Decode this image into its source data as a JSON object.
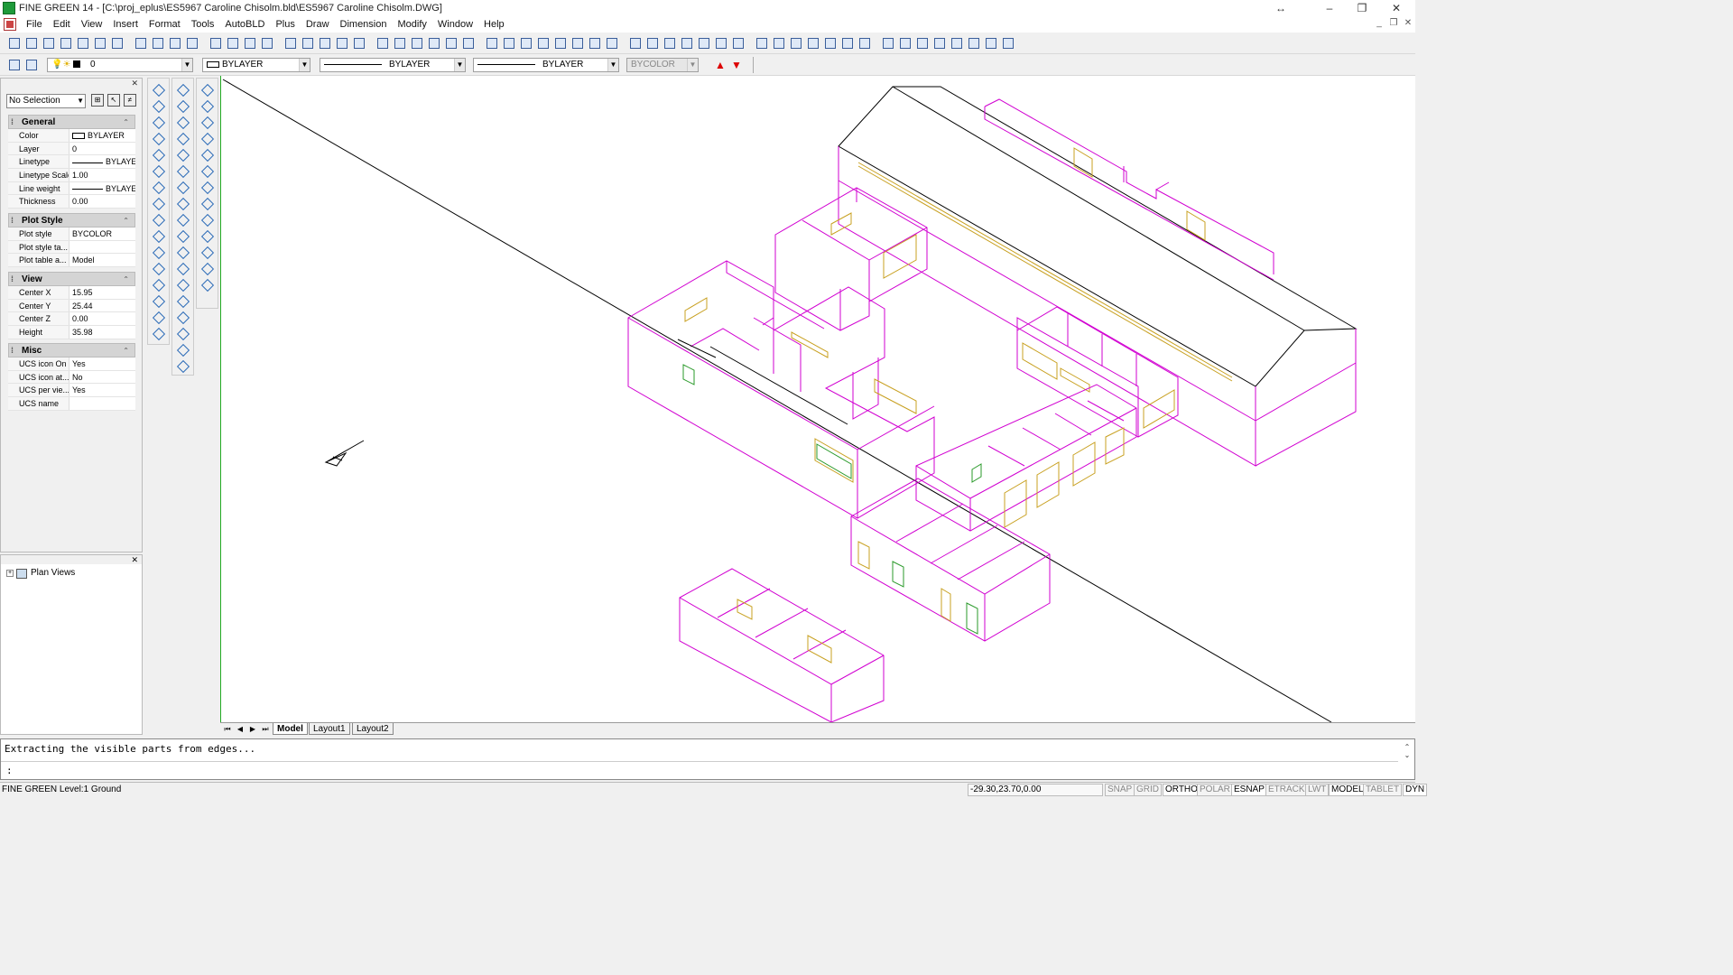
{
  "title": "FINE GREEN 14 - [C:\\proj_eplus\\ES5967 Caroline Chisolm.bld\\ES5967 Caroline Chisolm.DWG]",
  "menu": [
    "File",
    "Edit",
    "View",
    "Insert",
    "Format",
    "Tools",
    "AutoBLD",
    "Plus",
    "Draw",
    "Dimension",
    "Modify",
    "Window",
    "Help"
  ],
  "props_toolbar": {
    "layer": "0",
    "color": "BYLAYER",
    "linetype": "BYLAYER",
    "lineweight": "BYLAYER",
    "plotstyle": "BYCOLOR"
  },
  "properties": {
    "selection": "No Selection",
    "general": {
      "title": "General",
      "rows": [
        {
          "k": "Color",
          "v": "BYLAYER"
        },
        {
          "k": "Layer",
          "v": "0"
        },
        {
          "k": "Linetype",
          "v": "BYLAYE"
        },
        {
          "k": "Linetype Scale",
          "v": "1.00"
        },
        {
          "k": "Line weight",
          "v": "BYLAYE"
        },
        {
          "k": "Thickness",
          "v": "0.00"
        }
      ]
    },
    "plotstyle": {
      "title": "Plot Style",
      "rows": [
        {
          "k": "Plot style",
          "v": "BYCOLOR"
        },
        {
          "k": "Plot style ta...",
          "v": ""
        },
        {
          "k": "Plot table a...",
          "v": "Model"
        }
      ]
    },
    "view": {
      "title": "View",
      "rows": [
        {
          "k": "Center X",
          "v": "15.95"
        },
        {
          "k": "Center Y",
          "v": "25.44"
        },
        {
          "k": "Center Z",
          "v": "0.00"
        },
        {
          "k": "Height",
          "v": "35.98"
        }
      ]
    },
    "misc": {
      "title": "Misc",
      "rows": [
        {
          "k": "UCS icon On",
          "v": "Yes"
        },
        {
          "k": "UCS icon at...",
          "v": "No"
        },
        {
          "k": "UCS per vie...",
          "v": "Yes"
        },
        {
          "k": "UCS name",
          "v": ""
        }
      ]
    }
  },
  "plan_views": {
    "label": "Plan Views"
  },
  "tabs": [
    "Model",
    "Layout1",
    "Layout2"
  ],
  "command": {
    "history": "Extracting the visible parts from edges...",
    "prompt": ":"
  },
  "status": {
    "left": "FINE GREEN Level:1 Ground",
    "coords": "-29.30,23.70,0.00",
    "toggles": [
      {
        "label": "SNAP",
        "on": false
      },
      {
        "label": "GRID",
        "on": false
      },
      {
        "label": "ORTHO",
        "on": true
      },
      {
        "label": "POLAR",
        "on": false
      },
      {
        "label": "ESNAP",
        "on": true
      },
      {
        "label": "ETRACK",
        "on": false
      },
      {
        "label": "LWT",
        "on": false
      },
      {
        "label": "MODEL",
        "on": true
      },
      {
        "label": "TABLET",
        "on": false
      },
      {
        "label": "DYN",
        "on": true
      }
    ]
  },
  "colors": {
    "walls": "#d100d1",
    "openings": "#c8a020",
    "glass": "#2a9a2a",
    "roof": "#000000"
  }
}
